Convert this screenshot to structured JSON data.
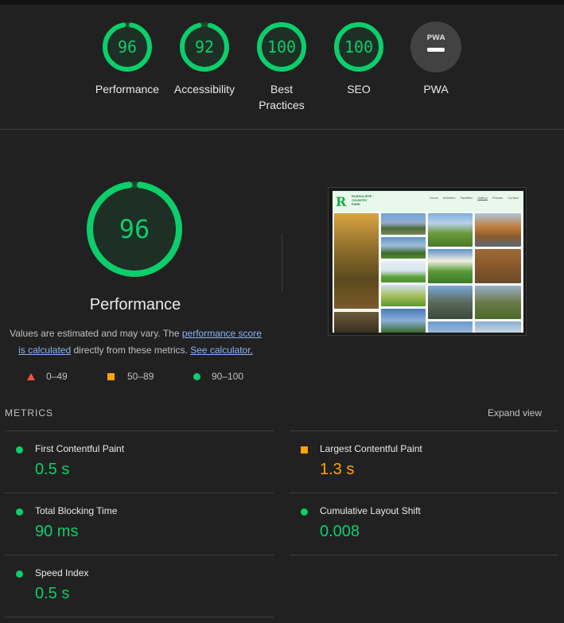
{
  "summary": {
    "gauges": [
      {
        "score": "96",
        "label": "Performance",
        "pass": 0.96
      },
      {
        "score": "92",
        "label": "Accessibility",
        "pass": 0.92
      },
      {
        "score": "100",
        "label": "Best Practices",
        "pass": 1.0
      },
      {
        "score": "100",
        "label": "SEO",
        "pass": 1.0
      },
      {
        "label": "PWA",
        "badge_text": "PWA"
      }
    ]
  },
  "performance": {
    "score": "96",
    "fill": 0.96,
    "title": "Performance",
    "desc_1": "Values are estimated and may vary. The ",
    "link_score": "performance score is calculated",
    "desc_2": " directly from these metrics. ",
    "link_calc": "See calculator.",
    "legend": {
      "fail": "0–49",
      "average": "50–89",
      "pass": "90–100"
    }
  },
  "screenshot": {
    "logo_text": "RUSHCLIFFE COUNTRY PARK",
    "nav": [
      "Home",
      "Activities",
      "Facilities",
      "Gallery",
      "Friends",
      "Contact"
    ]
  },
  "metrics": {
    "heading": "METRICS",
    "expand": "Expand view",
    "items": [
      {
        "name": "First Contentful Paint",
        "value": "0.5 s",
        "rating": "pass"
      },
      {
        "name": "Largest Contentful Paint",
        "value": "1.3 s",
        "rating": "average"
      },
      {
        "name": "Total Blocking Time",
        "value": "90 ms",
        "rating": "pass"
      },
      {
        "name": "Cumulative Layout Shift",
        "value": "0.008",
        "rating": "pass"
      },
      {
        "name": "Speed Index",
        "value": "0.5 s",
        "rating": "pass"
      }
    ]
  },
  "colors": {
    "pass": "#0cce6b",
    "average": "#ffa400",
    "fail": "#ff4e42",
    "background": "#212121"
  }
}
